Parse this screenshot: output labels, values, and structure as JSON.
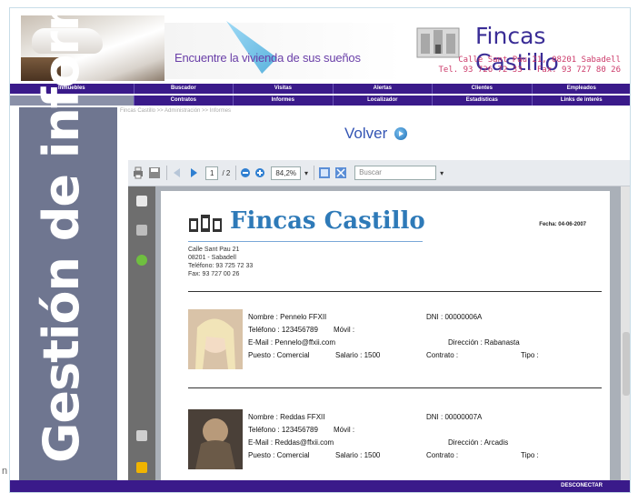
{
  "header": {
    "tagline": "Encuentre la vivienda de sus sueños",
    "brand": "Fincas Castillo",
    "address_line1": "Calle Sant Pau 21, 08201 Sabadell",
    "address_line2": "Tel. 93 726 72 33 - Fax. 93 727 80 26"
  },
  "nav_row1": [
    "Inmuebles",
    "Buscador",
    "Visitas",
    "Alertas",
    "Clientes",
    "Empleados"
  ],
  "nav_row2": [
    "",
    "Contratos",
    "Informes",
    "Localizador",
    "Estadísticas",
    "Links de interés"
  ],
  "sidebar": {
    "vertical_title": "Gestión de informes",
    "footer_text": "n"
  },
  "breadcrumb": "Fincas Castillo >> Administración >> Informes",
  "volver_label": "Volver",
  "pdf_toolbar": {
    "page_current": "1",
    "page_total": "/ 2",
    "zoom": "84,2%",
    "search_placeholder": "Buscar"
  },
  "document": {
    "brand": "Fincas Castillo",
    "fecha": "Fecha: 04-06-2007",
    "address": [
      "Calle Sant Pau 21",
      "08201 - Sabadell",
      "Teléfono: 93 725 72 33",
      "Fax: 93 727 00 26"
    ],
    "employees": [
      {
        "nombre": "Nombre : Pennelo FFXII",
        "dni": "DNI : 00000006A",
        "telefono": "Teléfono : 123456789",
        "movil": "Móvil :",
        "email": "E-Mail : Pennelo@ffxii.com",
        "direccion": "Dirección : Rabanasta",
        "puesto": "Puesto : Comercial",
        "salario": "Salario : 1500",
        "contrato": "Contrato :",
        "tipo": "Tipo :"
      },
      {
        "nombre": "Nombre : Reddas FFXII",
        "dni": "DNI : 00000007A",
        "telefono": "Teléfono : 123456789",
        "movil": "Móvil :",
        "email": "E-Mail : Reddas@ffxii.com",
        "direccion": "Dirección : Arcadis",
        "puesto": "Puesto : Comercial",
        "salario": "Salario : 1500",
        "contrato": "Contrato :",
        "tipo": "Tipo :"
      }
    ]
  },
  "footer": {
    "disconnect_label": "DESCONECTAR"
  },
  "colors": {
    "nav_bg": "#3a1a8a",
    "brand_text": "#3a2d96",
    "address_text": "#cc3a6a",
    "sidebar_bg": "#6f7690",
    "volver_text": "#3455b4"
  }
}
